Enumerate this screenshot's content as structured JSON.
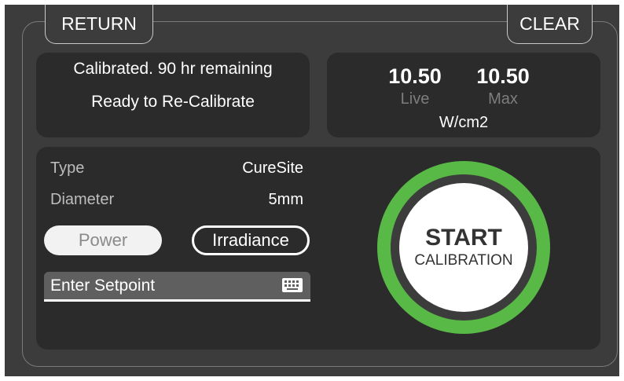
{
  "header": {
    "return_label": "RETURN",
    "clear_label": "CLEAR"
  },
  "status": {
    "line1": "Calibrated. 90 hr remaining",
    "line2": "Ready to Re-Calibrate"
  },
  "readings": {
    "live_value": "10.50",
    "live_label": "Live",
    "max_value": "10.50",
    "max_label": "Max",
    "unit": "W/cm2"
  },
  "properties": {
    "type_label": "Type",
    "type_value": "CureSite",
    "diameter_label": "Diameter",
    "diameter_value": "5mm"
  },
  "mode": {
    "power_label": "Power",
    "irradiance_label": "Irradiance",
    "selected": "Irradiance"
  },
  "setpoint": {
    "placeholder": "Enter Setpoint",
    "icon": "keyboard-icon"
  },
  "start": {
    "title": "START",
    "subtitle": "CALIBRATION"
  },
  "colors": {
    "accent_green": "#58b946",
    "background": "#3c3c3c",
    "panel": "#2b2b2b",
    "text": "#ffffff",
    "muted_text": "#7d7d7d"
  }
}
